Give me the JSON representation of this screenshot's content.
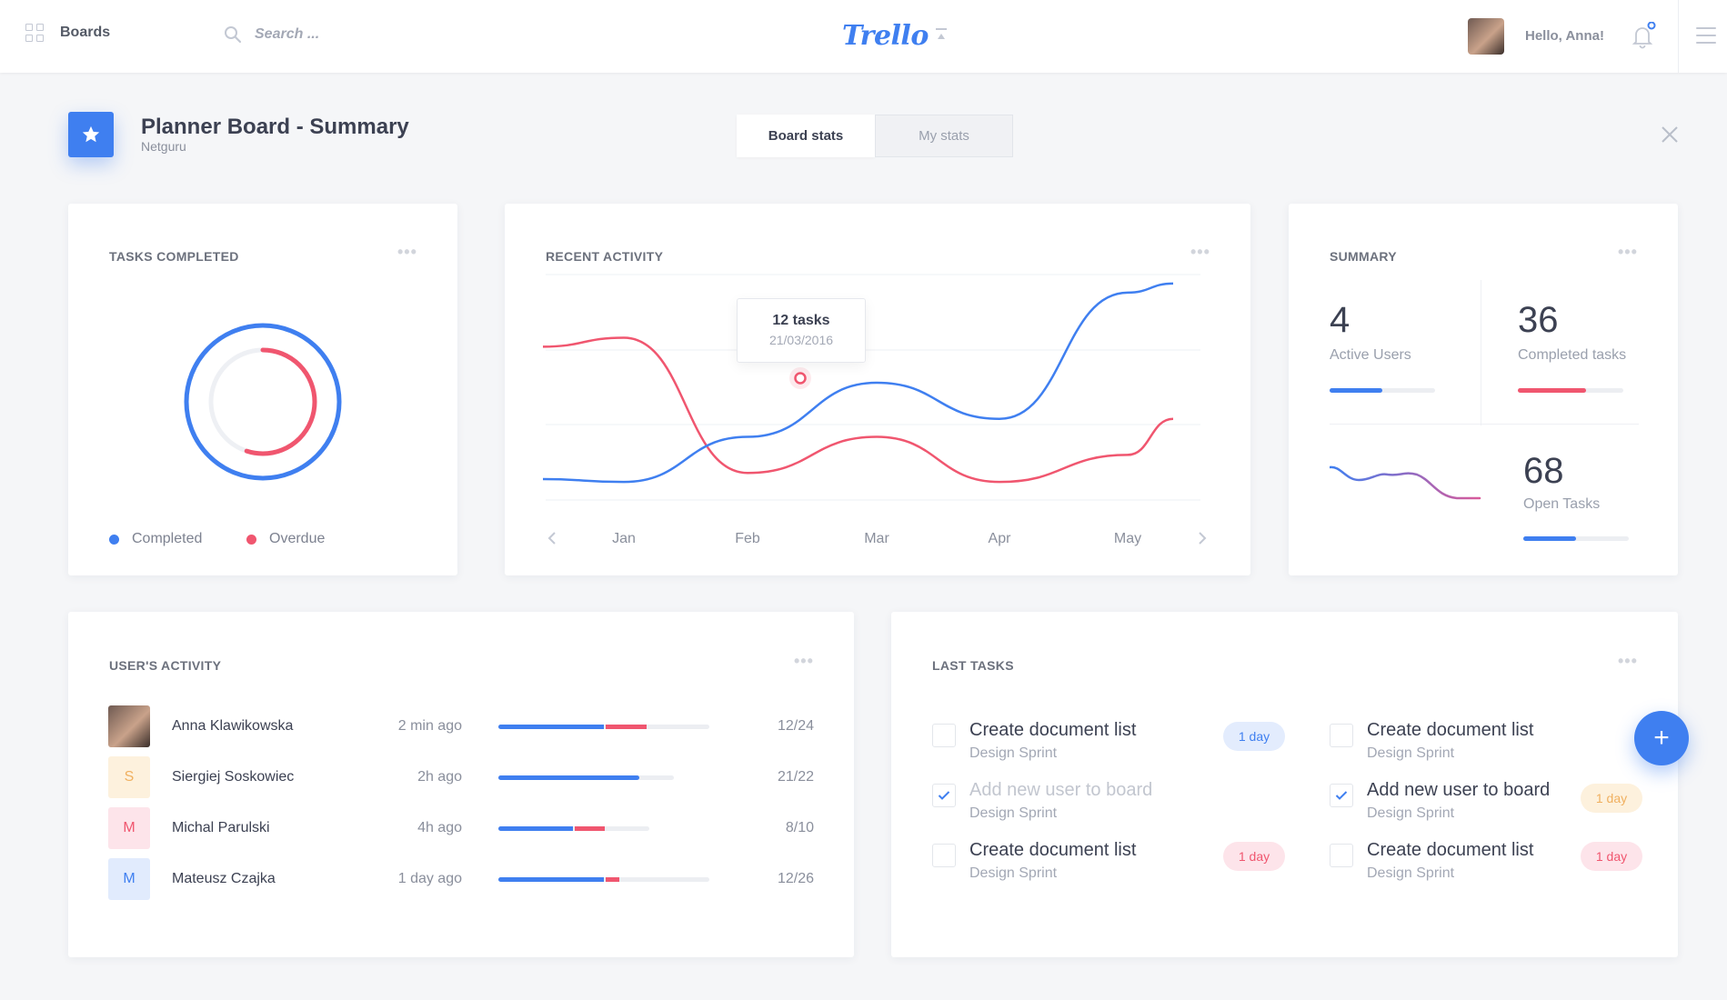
{
  "topbar": {
    "boards_label": "Boards",
    "search_placeholder": "Search ...",
    "logo": "Trello",
    "greeting": "Hello, Anna!",
    "icons": [
      "grid-icon",
      "search-icon",
      "collapse-icon",
      "bell-icon",
      "menu-icon"
    ]
  },
  "header": {
    "title": "Planner Board - Summary",
    "subtitle": "Netguru",
    "tabs": [
      {
        "label": "Board stats",
        "active": true
      },
      {
        "label": "My stats",
        "active": false
      }
    ]
  },
  "colors": {
    "blue": "#3f7ff0",
    "red": "#f0566f",
    "orange": "#f0b060",
    "background": "#f5f6f8"
  },
  "tasks_completed": {
    "title": "TASKS COMPLETED",
    "completed_fraction": 1.0,
    "overdue_fraction": 0.55,
    "legend": [
      {
        "label": "Completed",
        "color": "#3f7ff0"
      },
      {
        "label": "Overdue",
        "color": "#f0566f"
      }
    ]
  },
  "recent_activity": {
    "title": "RECENT ACTIVITY",
    "tooltip": {
      "value": "12 tasks",
      "date": "21/03/2016"
    }
  },
  "chart_data": {
    "type": "line",
    "title": "RECENT ACTIVITY",
    "categories": [
      "Jan",
      "Feb",
      "Mar",
      "Apr",
      "May"
    ],
    "series": [
      {
        "color": "#3f7ff0",
        "values": [
          2,
          7,
          13,
          9,
          23
        ]
      },
      {
        "color": "#f0566f",
        "values": [
          18,
          3,
          7,
          2,
          5
        ]
      }
    ],
    "ylim": [
      0,
      25
    ],
    "grid": true
  },
  "summary": {
    "title": "SUMMARY",
    "active_users": {
      "value": "4",
      "label": "Active Users",
      "progress": 0.5
    },
    "completed_tasks": {
      "value": "36",
      "label": "Completed tasks",
      "progress": 0.65
    },
    "open_tasks": {
      "value": "68",
      "label": "Open Tasks",
      "progress": 0.5
    }
  },
  "users_activity": {
    "title": "USER'S ACTIVITY",
    "users": [
      {
        "name": "Anna Klawikowska",
        "time": "2 min ago",
        "score": "12/24",
        "initial": "",
        "avatar_color": "#6f5a52",
        "initial_color": "#ffffff",
        "track": 1.0,
        "blue": 0.5,
        "red": 0.2
      },
      {
        "name": "Siergiej Soskowiec",
        "time": "2h ago",
        "score": "21/22",
        "initial": "S",
        "avatar_color": "#fdf1dd",
        "initial_color": "#f0b060",
        "track": 0.83,
        "blue": 0.8,
        "red": 0.0
      },
      {
        "name": "Michal Parulski",
        "time": "4h ago",
        "score": "8/10",
        "initial": "M",
        "avatar_color": "#fde4ea",
        "initial_color": "#f0566f",
        "track": 0.71,
        "blue": 0.5,
        "red": 0.2
      },
      {
        "name": "Mateusz Czajka",
        "time": "1 day ago",
        "score": "12/26",
        "initial": "M",
        "avatar_color": "#e1ebfd",
        "initial_color": "#3f7ff0",
        "track": 1.0,
        "blue": 0.5,
        "red": 0.07
      }
    ]
  },
  "last_tasks": {
    "title": "LAST TASKS",
    "tasks": [
      {
        "name": "Create document list",
        "sub": "Design Sprint",
        "checked": false,
        "badge": "1 day",
        "badge_type": "blue"
      },
      {
        "name": "Add new user to board",
        "sub": "Design Sprint",
        "checked": true,
        "badge": "",
        "badge_type": "none"
      },
      {
        "name": "Create document list",
        "sub": "Design Sprint",
        "checked": false,
        "badge": "1 day",
        "badge_type": "red"
      },
      {
        "name": "Create document list",
        "sub": "Design Sprint",
        "checked": false,
        "badge": "",
        "badge_type": "none"
      },
      {
        "name": "Add new user to board",
        "sub": "Design Sprint",
        "checked": true,
        "badge": "1 day",
        "badge_type": "orange"
      },
      {
        "name": "Create document list",
        "sub": "Design Sprint",
        "checked": false,
        "badge": "1 day",
        "badge_type": "red"
      }
    ],
    "add_button": "+"
  }
}
